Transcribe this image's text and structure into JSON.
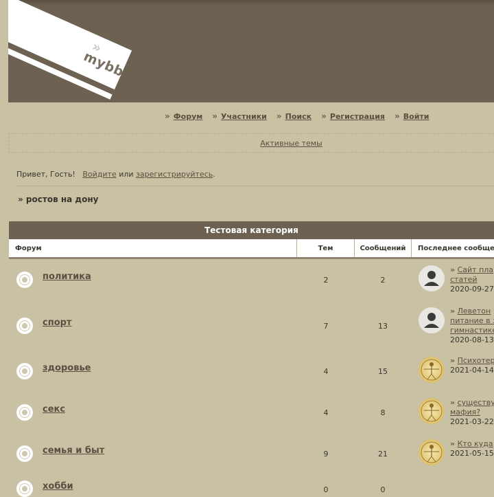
{
  "header": {
    "logo_text": "mybb"
  },
  "nav": [
    {
      "label": "Форум"
    },
    {
      "label": "Участники"
    },
    {
      "label": "Поиск"
    },
    {
      "label": "Регистрация"
    },
    {
      "label": "Войти"
    }
  ],
  "active_topics": "Активные темы",
  "welcome": {
    "greeting": "Привет, Гость!",
    "login_link": "Войдите",
    "or": "или",
    "register_link": "зарегистрируйтесь",
    "period": "."
  },
  "announcement": "» ростов на дону",
  "category": {
    "title": "Тестовая категория",
    "columns": {
      "forum": "Форум",
      "topics": "Тем",
      "posts": "Сообщений",
      "last_post": "Последнее сообщение"
    },
    "forums": [
      {
        "name": "политика",
        "topics": "2",
        "posts": "2",
        "avatar": "generic",
        "last_title": "Сайт платных статей",
        "last_title_line1": "Сайт пла",
        "last_title_line2": "статей",
        "last_date": "2020-09-27"
      },
      {
        "name": "спорт",
        "topics": "7",
        "posts": "13",
        "avatar": "generic",
        "last_title_line1": "Леветон",
        "last_title_line2": "питание в з",
        "last_title_line3": "гимнастике",
        "last_date": "2020-08-13"
      },
      {
        "name": "здоровье",
        "topics": "4",
        "posts": "15",
        "avatar": "vitruvian",
        "last_title_line1": "Психотер",
        "last_date": "2021-04-14"
      },
      {
        "name": "секс",
        "topics": "4",
        "posts": "8",
        "avatar": "vitruvian",
        "last_title_line1": "существу",
        "last_title_line2": "мафия?",
        "last_date": "2021-03-22"
      },
      {
        "name": "семья и быт",
        "topics": "9",
        "posts": "21",
        "avatar": "vitruvian",
        "last_title_line1": "Кто куда",
        "last_date": "2021-05-15"
      },
      {
        "name": "хобби",
        "topics": "0",
        "posts": "0"
      }
    ]
  },
  "icons": {
    "nav_bullet": "double-chevron-icon",
    "status": "forum-status-icon",
    "avatar_generic": "user-silhouette-icon",
    "avatar_vitruvian": "vitruvian-man-icon"
  },
  "colors": {
    "background": "#c9c1a3",
    "header": "#6d6152",
    "link": "#5a4f41"
  }
}
